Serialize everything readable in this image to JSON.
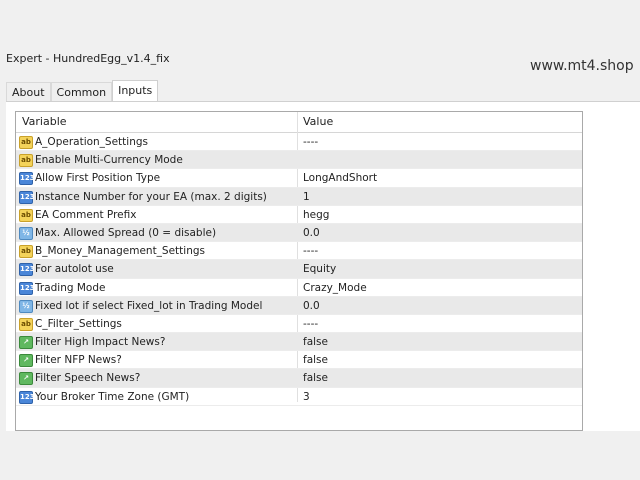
{
  "window": {
    "title": "Expert - HundredEgg_v1.4_fix"
  },
  "watermark": "www.mt4.shop",
  "tabs": [
    {
      "label": "About"
    },
    {
      "label": "Common"
    },
    {
      "label": "Inputs"
    }
  ],
  "grid": {
    "header": {
      "variable": "Variable",
      "value": "Value"
    },
    "rows": [
      {
        "icon": "ab",
        "variable": "A_Operation_Settings",
        "value": "----"
      },
      {
        "icon": "ab",
        "variable": "Enable Multi-Currency Mode",
        "value": ""
      },
      {
        "icon": "123",
        "variable": "Allow First Position Type",
        "value": "LongAndShort"
      },
      {
        "icon": "123",
        "variable": "Instance Number for your EA (max. 2 digits)",
        "value": "1"
      },
      {
        "icon": "ab",
        "variable": "EA Comment Prefix",
        "value": "hegg"
      },
      {
        "icon": "1/2",
        "variable": "Max. Allowed Spread (0 = disable)",
        "value": "0.0"
      },
      {
        "icon": "ab",
        "variable": "B_Money_Management_Settings",
        "value": "----"
      },
      {
        "icon": "123",
        "variable": "For autolot use",
        "value": "Equity"
      },
      {
        "icon": "123",
        "variable": "Trading Mode",
        "value": "Crazy_Mode"
      },
      {
        "icon": "1/2",
        "variable": "Fixed lot if select Fixed_lot in Trading Model",
        "value": "0.0"
      },
      {
        "icon": "ab",
        "variable": "C_Filter_Settings",
        "value": "----"
      },
      {
        "icon": "chart",
        "variable": "Filter High Impact News?",
        "value": "false"
      },
      {
        "icon": "chart",
        "variable": "Filter NFP News?",
        "value": "false"
      },
      {
        "icon": "chart",
        "variable": "Filter Speech News?",
        "value": "false"
      },
      {
        "icon": "123",
        "variable": "Your Broker Time Zone (GMT)",
        "value": "3"
      }
    ]
  }
}
